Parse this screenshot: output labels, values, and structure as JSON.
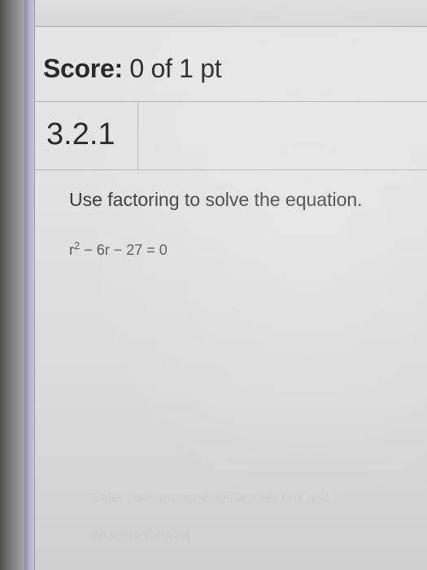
{
  "score": {
    "label": "Score:",
    "value": "0 of 1 pt"
  },
  "section": {
    "number": "3.2.1"
  },
  "question": {
    "instruction": "Use factoring to solve the equation.",
    "equation": {
      "base": "r",
      "exponent": "2",
      "rest": " − 6r − 27 = 0"
    }
  },
  "footer": {
    "line1": "Enter your answer in the answer box and",
    "line2": "All parts showing"
  }
}
